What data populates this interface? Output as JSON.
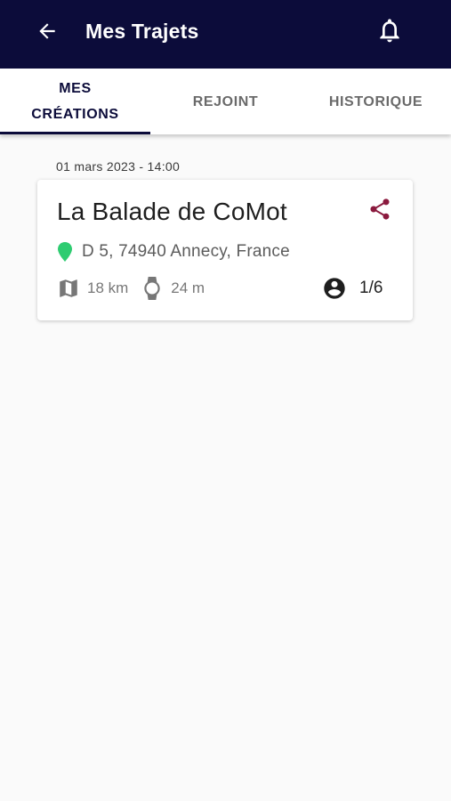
{
  "header": {
    "title": "Mes Trajets",
    "background_color": "#0c0c3a",
    "back_icon": "arrow-left-icon",
    "notification_icon": "bell-icon"
  },
  "tabs": [
    {
      "label": "MES CRÉATIONS",
      "line1": "MES",
      "line2": "CRÉATIONS",
      "selected": true
    },
    {
      "label": "REJOINT",
      "selected": false
    },
    {
      "label": "HISTORIQUE",
      "selected": false
    }
  ],
  "trip": {
    "date_time": "01 mars 2023 - 14:00",
    "title": "La Balade de CoMot",
    "location": "D 5, 74940 Annecy, France",
    "distance": "18 km",
    "duration": "24 m",
    "participants": "1/6",
    "share_icon": "share-icon",
    "location_icon": "map-pin-icon",
    "distance_icon": "map-icon",
    "duration_icon": "watch-icon",
    "participants_icon": "account-circle-icon",
    "share_color": "#8b1a3e",
    "pin_color": "#2ecc71"
  }
}
